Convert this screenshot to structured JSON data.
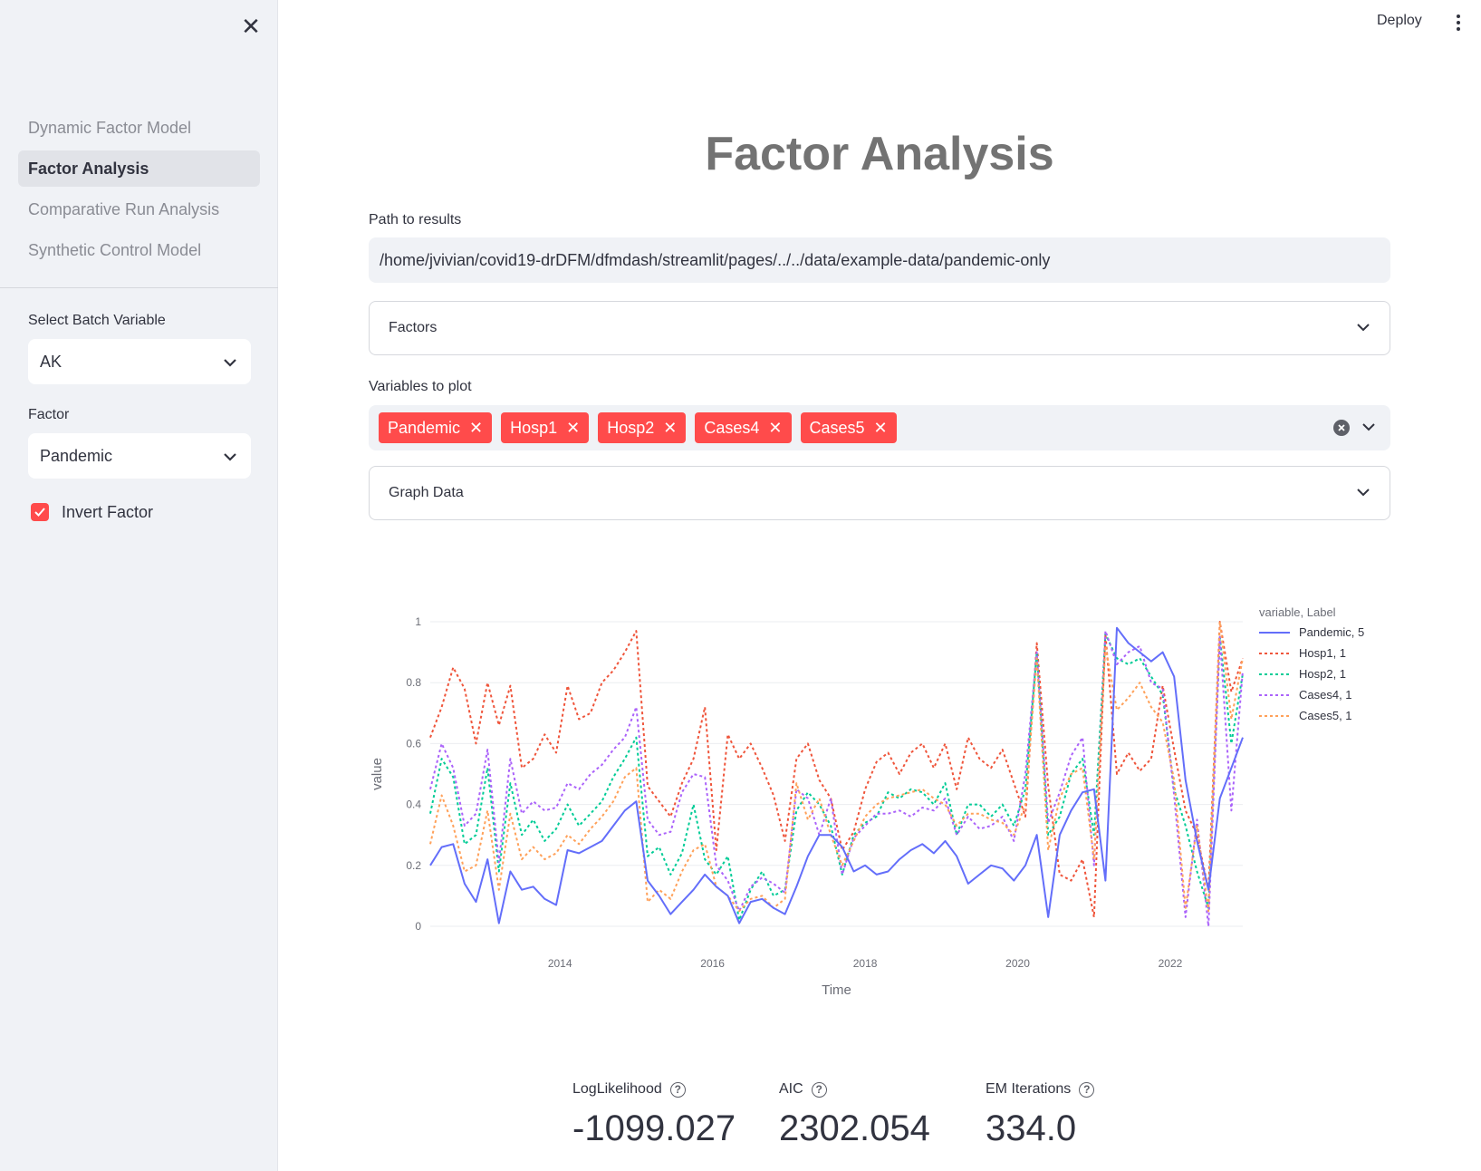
{
  "sidebar": {
    "nav": [
      {
        "label": "Dynamic Factor Model",
        "active": false
      },
      {
        "label": "Factor Analysis",
        "active": true
      },
      {
        "label": "Comparative Run Analysis",
        "active": false
      },
      {
        "label": "Synthetic Control Model",
        "active": false
      }
    ],
    "batch_label": "Select Batch Variable",
    "batch_value": "AK",
    "factor_label": "Factor",
    "factor_value": "Pandemic",
    "invert_label": "Invert Factor",
    "invert_checked": true
  },
  "header": {
    "deploy_label": "Deploy"
  },
  "main": {
    "title": "Factor Analysis",
    "path_label": "Path to results",
    "path_value": "/home/jvivian/covid19-drDFM/dfmdash/streamlit/pages/../../data/example-data/pandemic-only",
    "factors_expander": "Factors",
    "vars_label": "Variables to plot",
    "tags": [
      "Pandemic",
      "Hosp1",
      "Hosp2",
      "Cases4",
      "Cases5"
    ],
    "graph_expander": "Graph Data"
  },
  "colors": {
    "accent": "#ff4b4b",
    "Pandemic": "#636efa",
    "Hosp1": "#ef553b",
    "Hosp2": "#00cc96",
    "Cases4": "#ab63fa",
    "Cases5": "#ffa15a"
  },
  "chart_data": {
    "type": "line",
    "title": "",
    "xlabel": "Time",
    "ylabel": "value",
    "xlim": [
      2012.3,
      2022.95
    ],
    "ylim": [
      0,
      1
    ],
    "x_ticks": [
      "2014",
      "2016",
      "2018",
      "2020",
      "2022"
    ],
    "y_ticks": [
      "0",
      "0.2",
      "0.4",
      "0.6",
      "0.8",
      "1"
    ],
    "legend_title": "variable, Label",
    "legend_position": "right",
    "x": [
      2012.3,
      2012.45,
      2012.6,
      2012.75,
      2012.9,
      2013.05,
      2013.2,
      2013.35,
      2013.5,
      2013.65,
      2013.8,
      2013.95,
      2014.1,
      2014.25,
      2014.4,
      2014.55,
      2014.7,
      2014.85,
      2015.0,
      2015.15,
      2015.3,
      2015.45,
      2015.6,
      2015.75,
      2015.9,
      2016.05,
      2016.2,
      2016.35,
      2016.5,
      2016.65,
      2016.8,
      2016.95,
      2017.1,
      2017.25,
      2017.4,
      2017.55,
      2017.7,
      2017.85,
      2018.0,
      2018.15,
      2018.3,
      2018.45,
      2018.6,
      2018.75,
      2018.9,
      2019.05,
      2019.2,
      2019.35,
      2019.5,
      2019.65,
      2019.8,
      2019.95,
      2020.1,
      2020.25,
      2020.4,
      2020.55,
      2020.7,
      2020.85,
      2021.0,
      2021.15,
      2021.3,
      2021.45,
      2021.6,
      2021.75,
      2021.9,
      2022.05,
      2022.2,
      2022.35,
      2022.5,
      2022.65,
      2022.8,
      2022.95
    ],
    "series": [
      {
        "name": "Pandemic, 5",
        "dash": "solid",
        "values": [
          0.2,
          0.26,
          0.27,
          0.14,
          0.08,
          0.22,
          0.01,
          0.18,
          0.12,
          0.13,
          0.09,
          0.07,
          0.25,
          0.24,
          0.26,
          0.28,
          0.33,
          0.38,
          0.41,
          0.15,
          0.1,
          0.04,
          0.08,
          0.12,
          0.17,
          0.13,
          0.1,
          0.01,
          0.08,
          0.09,
          0.06,
          0.04,
          0.13,
          0.23,
          0.3,
          0.3,
          0.26,
          0.18,
          0.2,
          0.17,
          0.18,
          0.22,
          0.25,
          0.27,
          0.24,
          0.28,
          0.23,
          0.14,
          0.17,
          0.2,
          0.19,
          0.15,
          0.2,
          0.3,
          0.03,
          0.3,
          0.38,
          0.44,
          0.45,
          0.15,
          0.98,
          0.93,
          0.9,
          0.87,
          0.9,
          0.82,
          0.48,
          0.28,
          0.12,
          0.42,
          0.52,
          0.62
        ]
      },
      {
        "name": "Hosp1, 1",
        "dash": "dot",
        "values": [
          0.62,
          0.72,
          0.85,
          0.78,
          0.6,
          0.8,
          0.66,
          0.79,
          0.52,
          0.55,
          0.63,
          0.57,
          0.79,
          0.68,
          0.7,
          0.8,
          0.84,
          0.9,
          0.97,
          0.46,
          0.41,
          0.36,
          0.47,
          0.55,
          0.72,
          0.25,
          0.63,
          0.55,
          0.6,
          0.52,
          0.43,
          0.28,
          0.55,
          0.6,
          0.48,
          0.42,
          0.25,
          0.31,
          0.45,
          0.54,
          0.57,
          0.5,
          0.57,
          0.6,
          0.52,
          0.6,
          0.45,
          0.62,
          0.55,
          0.52,
          0.58,
          0.47,
          0.36,
          0.93,
          0.46,
          0.17,
          0.15,
          0.22,
          0.03,
          0.96,
          0.5,
          0.57,
          0.51,
          0.55,
          0.79,
          0.58,
          0.38,
          0.3,
          0.12,
          1.0,
          0.77,
          0.88
        ]
      },
      {
        "name": "Hosp2, 1",
        "dash": "dot",
        "values": [
          0.37,
          0.55,
          0.49,
          0.27,
          0.3,
          0.52,
          0.18,
          0.47,
          0.3,
          0.35,
          0.28,
          0.32,
          0.4,
          0.33,
          0.37,
          0.41,
          0.49,
          0.55,
          0.62,
          0.23,
          0.26,
          0.17,
          0.24,
          0.4,
          0.22,
          0.17,
          0.23,
          0.02,
          0.12,
          0.18,
          0.1,
          0.12,
          0.38,
          0.44,
          0.4,
          0.33,
          0.17,
          0.3,
          0.34,
          0.36,
          0.44,
          0.42,
          0.45,
          0.44,
          0.4,
          0.47,
          0.3,
          0.4,
          0.4,
          0.36,
          0.4,
          0.33,
          0.45,
          0.9,
          0.3,
          0.36,
          0.5,
          0.55,
          0.3,
          0.96,
          0.88,
          0.86,
          0.88,
          0.82,
          0.76,
          0.45,
          0.33,
          0.18,
          0.06,
          0.95,
          0.6,
          0.83
        ]
      },
      {
        "name": "Cases4, 1",
        "dash": "dot",
        "values": [
          0.45,
          0.6,
          0.52,
          0.33,
          0.37,
          0.58,
          0.21,
          0.55,
          0.37,
          0.41,
          0.38,
          0.39,
          0.47,
          0.45,
          0.5,
          0.53,
          0.58,
          0.62,
          0.72,
          0.35,
          0.3,
          0.31,
          0.44,
          0.5,
          0.49,
          0.2,
          0.15,
          0.05,
          0.13,
          0.16,
          0.14,
          0.11,
          0.45,
          0.42,
          0.3,
          0.42,
          0.17,
          0.29,
          0.33,
          0.37,
          0.37,
          0.38,
          0.36,
          0.39,
          0.38,
          0.42,
          0.3,
          0.36,
          0.32,
          0.33,
          0.36,
          0.28,
          0.5,
          0.9,
          0.34,
          0.44,
          0.56,
          0.62,
          0.2,
          0.97,
          0.86,
          0.9,
          0.92,
          0.8,
          0.78,
          0.43,
          0.03,
          0.35,
          0.0,
          0.95,
          0.38,
          0.84
        ]
      },
      {
        "name": "Cases5, 1",
        "dash": "dot",
        "values": [
          0.27,
          0.43,
          0.33,
          0.18,
          0.2,
          0.38,
          0.12,
          0.37,
          0.22,
          0.26,
          0.22,
          0.24,
          0.3,
          0.27,
          0.32,
          0.36,
          0.41,
          0.49,
          0.52,
          0.08,
          0.12,
          0.09,
          0.18,
          0.25,
          0.27,
          0.13,
          0.1,
          0.05,
          0.09,
          0.1,
          0.06,
          0.09,
          0.47,
          0.35,
          0.42,
          0.3,
          0.2,
          0.28,
          0.36,
          0.4,
          0.42,
          0.43,
          0.44,
          0.45,
          0.42,
          0.4,
          0.33,
          0.37,
          0.37,
          0.35,
          0.34,
          0.3,
          0.4,
          0.88,
          0.25,
          0.42,
          0.5,
          0.52,
          0.22,
          0.92,
          0.71,
          0.75,
          0.8,
          0.72,
          0.67,
          0.48,
          0.06,
          0.33,
          0.05,
          1.0,
          0.68,
          0.88
        ]
      }
    ]
  },
  "metrics": [
    {
      "label": "LogLikelihood",
      "value": "-1099.027"
    },
    {
      "label": "AIC",
      "value": "2302.054"
    },
    {
      "label": "EM Iterations",
      "value": "334.0"
    }
  ]
}
